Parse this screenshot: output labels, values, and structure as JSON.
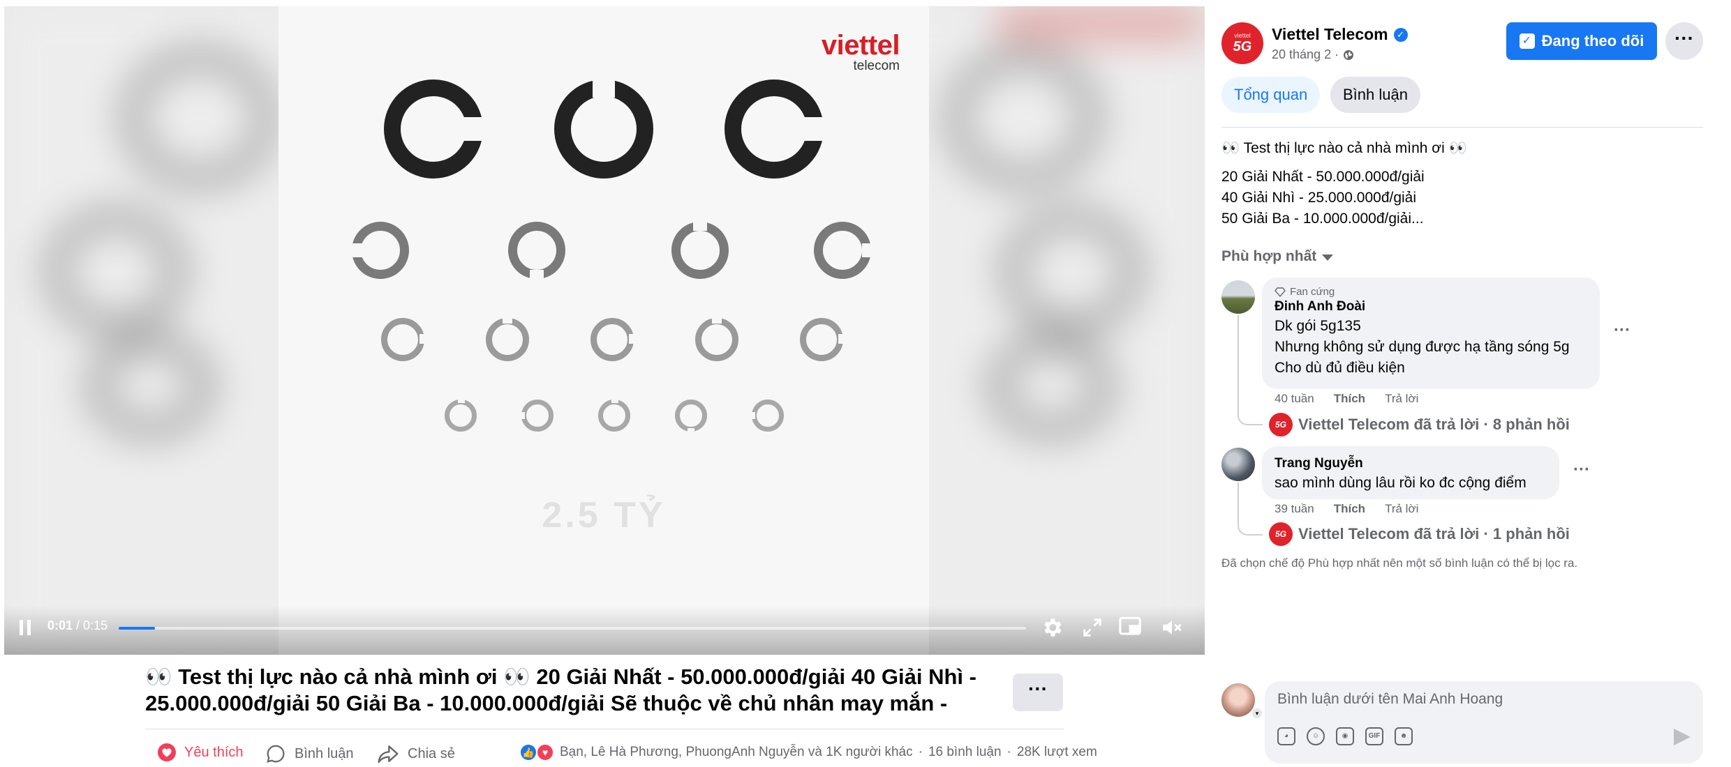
{
  "video": {
    "brand_name": "viettel",
    "brand_sub": "telecom",
    "ghost_text": "2.5 TỶ",
    "time_current": "0:01",
    "time_total": "/ 0:15",
    "progress_fraction": 0.04,
    "icons": [
      "pause-icon",
      "gear-icon",
      "fullscreen-icon",
      "miniplayer-icon",
      "volume-muted-icon"
    ]
  },
  "post": {
    "caption": "👀 Test thị lực nào cả nhà mình ơi 👀 20 Giải Nhất - 50.000.000đ/giải 40 Giải Nhì - 25.000.000đ/giải 50 Giải Ba - 10.000.000đ/giải Sẽ thuộc về chủ nhân may mắn - khi...",
    "more_label": "···",
    "actions": {
      "like": "Yêu thích",
      "comment": "Bình luận",
      "share": "Chia sẻ"
    },
    "reactions_text": "Bạn, Lê Hà Phương, PhuongAnh Nguyễn và 1K người khác",
    "comments_count": "16 bình luận",
    "views": "28K lượt xem"
  },
  "panel": {
    "page_name": "Viettel Telecom",
    "date": "20 tháng 2 ·",
    "follow_label": "Đang theo dõi",
    "more_label": "···",
    "tabs": [
      "Tổng quan",
      "Bình luận"
    ],
    "post_lines": [
      "👀 Test thị lực nào cả nhà mình ơi 👀",
      "20 Giải Nhất - 50.000.000đ/giải",
      "40 Giải Nhì - 25.000.000đ/giải",
      "50 Giải Ba - 10.000.000đ/giải..."
    ],
    "sort_label": "Phù hợp nhất",
    "comments": [
      {
        "badge": "Fan cứng",
        "author": "Đinh Anh Đoài",
        "lines": [
          "Dk gói 5g135",
          "Nhưng không sử dụng được hạ tầng sóng 5g",
          "Cho dù đủ điều kiện"
        ],
        "age": "40 tuần",
        "like": "Thích",
        "reply": "Trả lời",
        "replies_text": "Viettel Telecom đã trả lời · 8 phản hồi"
      },
      {
        "author": "Trang Nguyễn",
        "lines": [
          "sao mình dùng lâu rồi ko đc cộng điểm"
        ],
        "age": "39 tuần",
        "like": "Thích",
        "reply": "Trả lời",
        "replies_text": "Viettel Telecom đã trả lời · 1 phản hồi"
      }
    ],
    "filter_note": "Đã chọn chế độ Phù hợp nhất nên một số bình luận có thể bị lọc ra.",
    "composer_placeholder": "Bình luận dưới tên Mai Anh Hoang"
  }
}
